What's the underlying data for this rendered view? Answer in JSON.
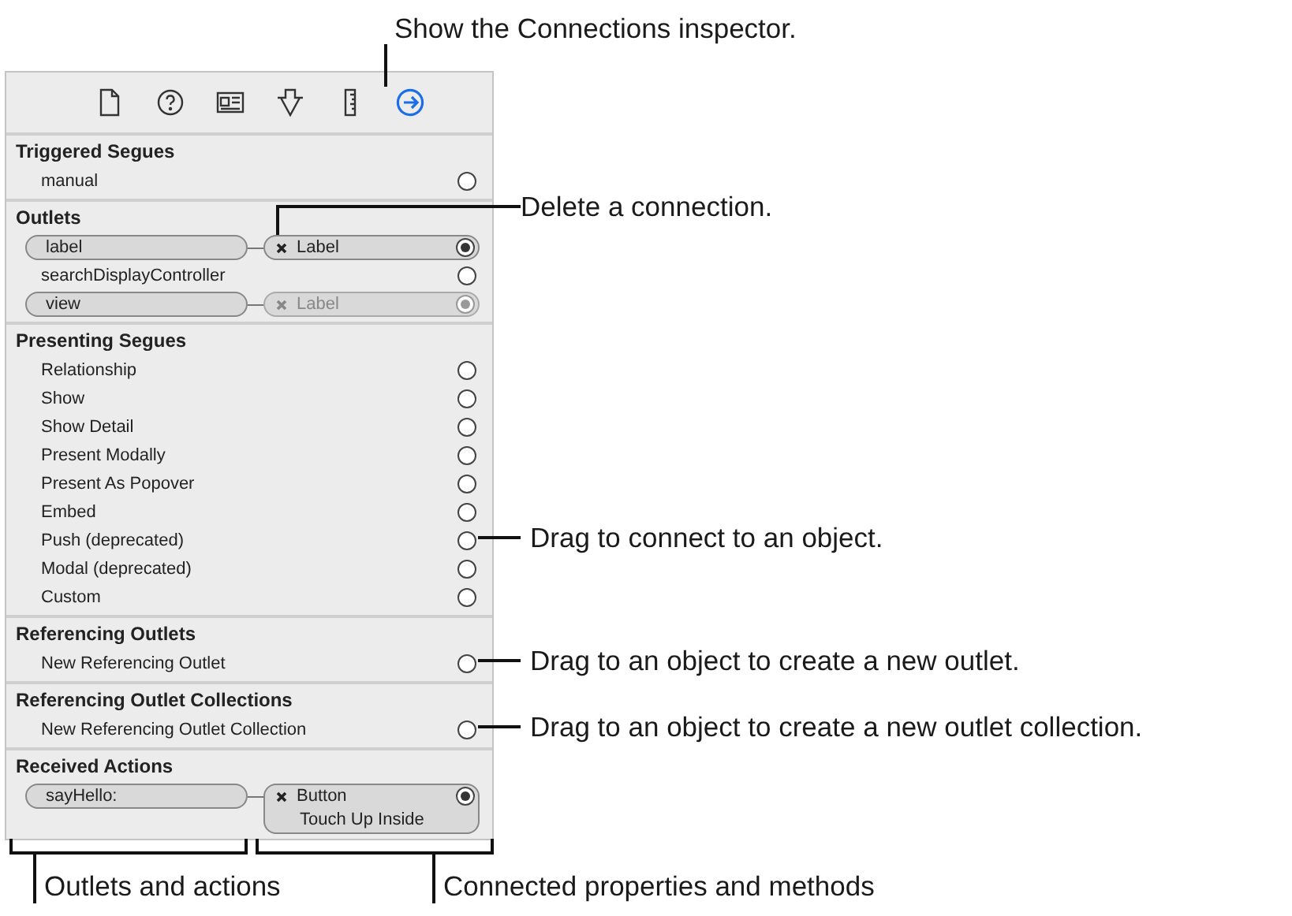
{
  "toolbar": [
    {
      "selected": false
    },
    {
      "selected": false
    },
    {
      "selected": false
    },
    {
      "selected": false
    },
    {
      "selected": false
    },
    {
      "selected": true
    }
  ],
  "sections": [
    {
      "title": "Triggered Segues",
      "rows": [
        {
          "kind": "plain",
          "name": "manual"
        }
      ]
    },
    {
      "title": "Outlets",
      "rows": [
        {
          "kind": "connected",
          "name": "label",
          "target": "Label",
          "dimmed": false
        },
        {
          "kind": "plain",
          "name": "searchDisplayController"
        },
        {
          "kind": "connected",
          "name": "view",
          "target": "Label",
          "dimmed": true
        }
      ]
    },
    {
      "title": "Presenting Segues",
      "rows": [
        {
          "kind": "plain",
          "name": "Relationship"
        },
        {
          "kind": "plain",
          "name": "Show"
        },
        {
          "kind": "plain",
          "name": "Show Detail"
        },
        {
          "kind": "plain",
          "name": "Present Modally"
        },
        {
          "kind": "plain",
          "name": "Present As Popover"
        },
        {
          "kind": "plain",
          "name": "Embed"
        },
        {
          "kind": "plain",
          "name": "Push (deprecated)"
        },
        {
          "kind": "plain",
          "name": "Modal (deprecated)"
        },
        {
          "kind": "plain",
          "name": "Custom"
        }
      ]
    },
    {
      "title": "Referencing Outlets",
      "rows": [
        {
          "kind": "plain",
          "name": "New Referencing Outlet"
        }
      ]
    },
    {
      "title": "Referencing Outlet Collections",
      "rows": [
        {
          "kind": "plain",
          "name": "New Referencing Outlet Collection"
        }
      ]
    },
    {
      "title": "Received Actions",
      "rows": [
        {
          "kind": "connected",
          "name": "sayHello:",
          "target": "Button",
          "event": "Touch Up Inside",
          "dimmed": false
        }
      ]
    }
  ],
  "callouts": [
    {
      "text": "Show the Connections inspector."
    },
    {
      "text": "Delete a connection."
    },
    {
      "text": "Drag to connect to an object."
    },
    {
      "text": "Drag to an object to create a new outlet."
    },
    {
      "text": "Drag to an object to create a new outlet collection."
    }
  ],
  "brackets": [
    {
      "text": "Outlets and actions"
    },
    {
      "text": "Connected properties and methods"
    }
  ]
}
